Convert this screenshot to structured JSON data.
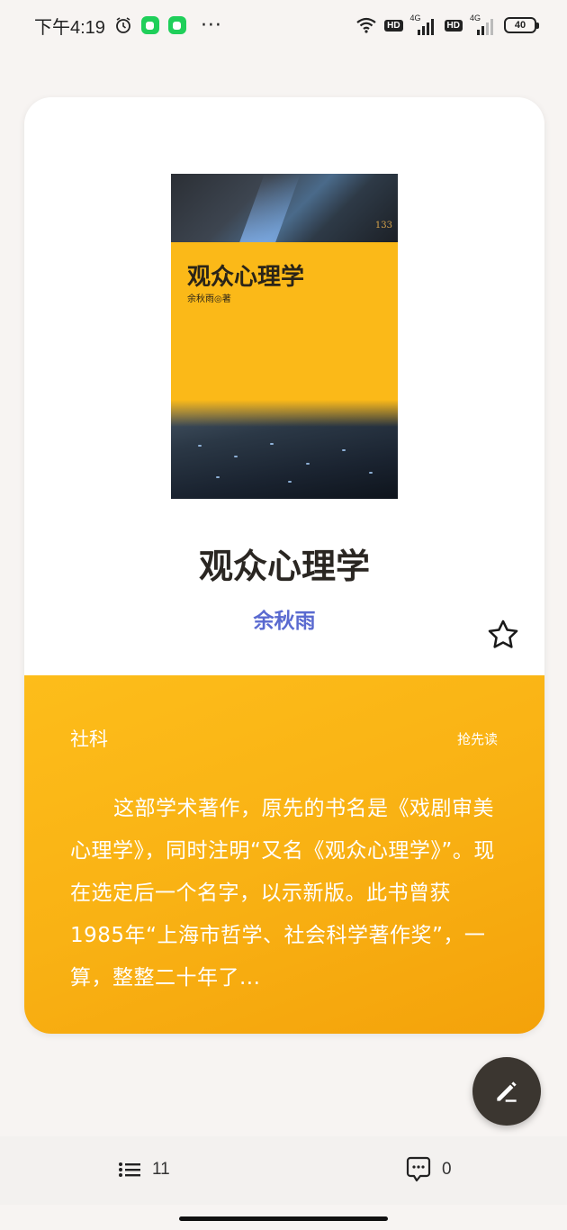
{
  "status_bar": {
    "time": "下午4:19",
    "more": "···",
    "hd1": "HD",
    "net1": "4G",
    "hd2": "HD",
    "net2": "4G",
    "battery": "40"
  },
  "book": {
    "cover_title": "观众心理学",
    "cover_author": "余秋雨◎著",
    "cover_number": "133",
    "title": "观众心理学",
    "author": "余秋雨",
    "category": "社科",
    "pre_read_label": "抢先读",
    "description": "这部学术著作，原先的书名是《戏剧审美心理学》，同时注明“又名《观众心理学》”。现在选定后一个名字，以示新版。此书曾获1985年“上海市哲学、社会科学著作奖”，一算，整整二十年了..."
  },
  "bottom_bar": {
    "chapters_count": "11",
    "comments_count": "0"
  },
  "colors": {
    "accent_yellow": "#fbb918",
    "author_blue": "#5a6ad0",
    "fab_dark": "#3b3630"
  },
  "icons": [
    "alarm-icon",
    "app-badge-icon",
    "wifi-icon",
    "signal-icon",
    "battery-icon",
    "star-icon",
    "edit-icon",
    "list-icon",
    "comment-icon"
  ]
}
